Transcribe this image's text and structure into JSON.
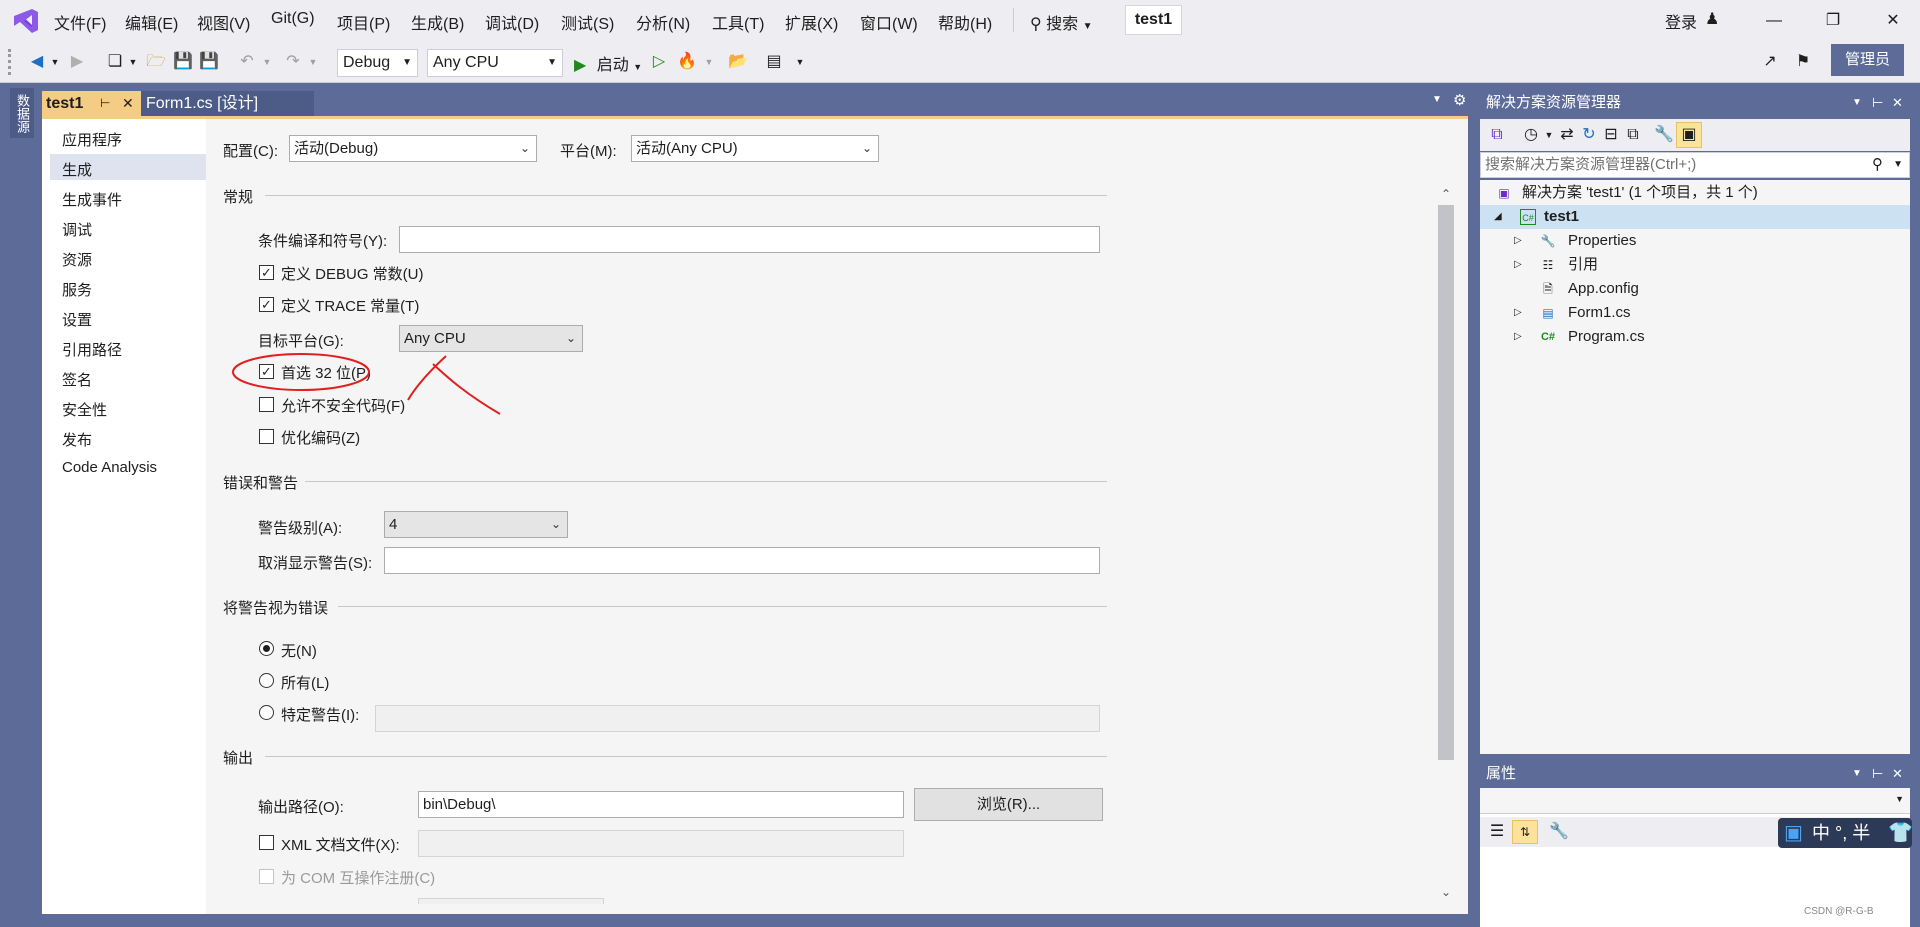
{
  "menubar": {
    "items": [
      "文件(F)",
      "编辑(E)",
      "视图(V)",
      "Git(G)",
      "项目(P)",
      "生成(B)",
      "调试(D)",
      "测试(S)",
      "分析(N)",
      "工具(T)",
      "扩展(X)",
      "窗口(W)",
      "帮助(H)"
    ],
    "search_label": "搜索",
    "solution_title": "test1",
    "login_label": "登录"
  },
  "toolbar": {
    "config_value": "Debug",
    "platform_value": "Any CPU",
    "start_label": "启动",
    "admin_label": "管理员"
  },
  "side_strip": {
    "tab_label": "数据源"
  },
  "doc_tabs": {
    "active": "test1",
    "inactive": "Form1.cs [设计]"
  },
  "nav": {
    "items": [
      "应用程序",
      "生成",
      "生成事件",
      "调试",
      "资源",
      "服务",
      "设置",
      "引用路径",
      "签名",
      "安全性",
      "发布",
      "Code Analysis"
    ],
    "selected_index": 1
  },
  "config_bar": {
    "config_label": "配置(C):",
    "config_value": "活动(Debug)",
    "platform_label": "平台(M):",
    "platform_value": "活动(Any CPU)"
  },
  "general": {
    "section": "常规",
    "conditional_label": "条件编译和符号(Y):",
    "conditional_value": "",
    "define_debug": "定义 DEBUG 常数(U)",
    "define_trace": "定义 TRACE 常量(T)",
    "target_label": "目标平台(G):",
    "target_value": "Any CPU",
    "prefer32": "首选 32 位(P)",
    "unsafe": "允许不安全代码(F)",
    "optimize": "优化编码(Z)"
  },
  "errors": {
    "section": "错误和警告",
    "level_label": "警告级别(A):",
    "level_value": "4",
    "suppress_label": "取消显示警告(S):",
    "suppress_value": ""
  },
  "treat_warnings": {
    "section": "将警告视为错误",
    "none": "无(N)",
    "all": "所有(L)",
    "specific": "特定警告(I):"
  },
  "output": {
    "section": "输出",
    "path_label": "输出路径(O):",
    "path_value": "bin\\Debug\\",
    "browse_label": "浏览(R)...",
    "xml_label": "XML 文档文件(X):",
    "com_label": "为 COM 互操作注册(C)"
  },
  "solution_explorer": {
    "title": "解决方案资源管理器",
    "search_placeholder": "搜索解决方案资源管理器(Ctrl+;)",
    "solution_row": "解决方案 'test1' (1 个项目，共 1 个)",
    "project": "test1",
    "nodes": [
      "Properties",
      "引用",
      "App.config",
      "Form1.cs",
      "Program.cs"
    ]
  },
  "properties": {
    "title": "属性"
  },
  "ime": {
    "text": "中 °, 半"
  },
  "watermark": "CSDN @R-G-B",
  "colors": {
    "accent": "#5d6b99",
    "active_tab": "#f5cc84",
    "annotation_red": "#e02020"
  }
}
